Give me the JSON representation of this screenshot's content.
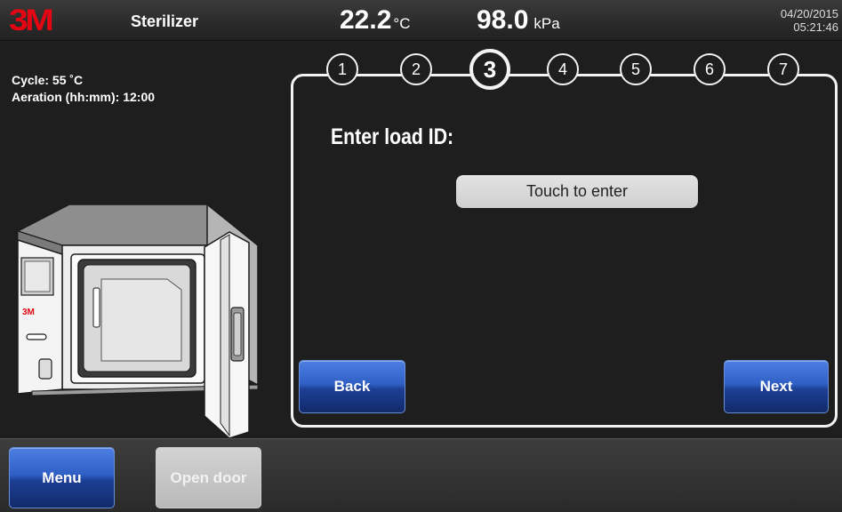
{
  "header": {
    "logo": "3M",
    "title": "Sterilizer",
    "temperature": {
      "value": "22.2",
      "unit": "°C"
    },
    "pressure": {
      "value": "98.0",
      "unit": "kPa"
    },
    "date": "04/20/2015",
    "time": "05:21:46"
  },
  "info": {
    "cycle": "Cycle: 55 ˚C",
    "aeration": "Aeration (hh:mm): 12:00"
  },
  "wizard": {
    "steps": [
      "1",
      "2",
      "3",
      "4",
      "5",
      "6",
      "7"
    ],
    "active_step": "3",
    "heading": "Enter load ID:",
    "entry_placeholder": "Touch to enter",
    "back_label": "Back",
    "next_label": "Next"
  },
  "footer": {
    "menu_label": "Menu",
    "open_door_label": "Open door"
  },
  "colors": {
    "brand": "#e30613",
    "button_blue": "#2f5fc4",
    "disabled_button": "#c4c4c4",
    "background": "#1e1e1e"
  },
  "machine": {
    "logo": "3M"
  }
}
